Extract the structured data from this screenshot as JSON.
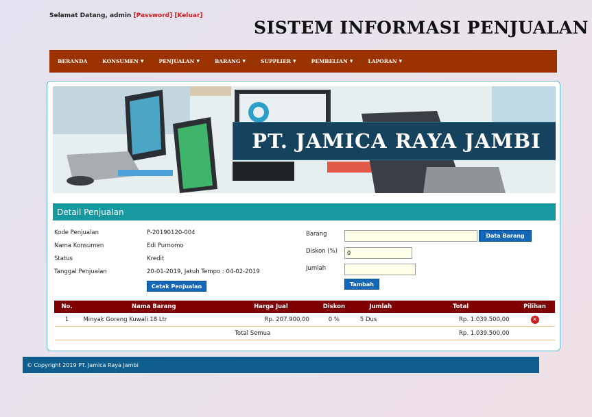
{
  "header": {
    "welcome_prefix": "Selamat Datang, admin",
    "password_link": "[Password]",
    "logout_link": "[Keluar]",
    "site_title": "SISTEM INFORMASI PENJUALAN"
  },
  "nav": [
    {
      "label": "BERANDA",
      "has_dropdown": false
    },
    {
      "label": "KONSUMEN",
      "has_dropdown": true
    },
    {
      "label": "PENJUALAN",
      "has_dropdown": true
    },
    {
      "label": "BARANG",
      "has_dropdown": true
    },
    {
      "label": "SUPPLIER",
      "has_dropdown": true
    },
    {
      "label": "PEMBELIAN",
      "has_dropdown": true
    },
    {
      "label": "LAPORAN",
      "has_dropdown": true
    }
  ],
  "banner": {
    "title": "PT. JAMICA RAYA JAMBI"
  },
  "section": {
    "title": "Detail Penjualan"
  },
  "info": {
    "kode_label": "Kode Penjualan",
    "kode_value": "P-20190120-004",
    "konsumen_label": "Nama Konsumen",
    "konsumen_value": "Edi Purnomo",
    "status_label": "Status",
    "status_value": "Kredit",
    "tanggal_label": "Tanggal Penjualan",
    "tanggal_value": "20-01-2019, Jatuh Tempo : 04-02-2019",
    "print_button": "Cetak Penjualan"
  },
  "form": {
    "barang_label": "Barang",
    "barang_value": "",
    "data_barang_button": "Data Barang",
    "diskon_label": "Diskon (%)",
    "diskon_value": "0",
    "jumlah_label": "Jumlah",
    "jumlah_value": "",
    "add_button": "Tambah"
  },
  "table": {
    "headers": {
      "no": "No.",
      "nama": "Nama Barang",
      "harga": "Harga Jual",
      "diskon": "Diskon",
      "jumlah": "Jumlah",
      "total": "Total",
      "pilihan": "Pilihan"
    },
    "rows": [
      {
        "no": "1",
        "nama": "Minyak Goreng Kuwali 18 Ltr",
        "harga": "Rp. 207.900,00",
        "diskon": "0 %",
        "jumlah": "5 Dus",
        "total": "Rp. 1.039.500,00"
      }
    ],
    "total_label": "Total Semua",
    "total_value": "Rp. 1.039.500,00"
  },
  "footer": {
    "text": "© Copyright 2019 PT. Jamica Raya Jambi"
  },
  "colors": {
    "nav": "#9b3300",
    "section": "#17979e",
    "table_header": "#7e0000",
    "button": "#1568b8",
    "footer": "#0f5e8e",
    "delete": "#c81e1e"
  }
}
